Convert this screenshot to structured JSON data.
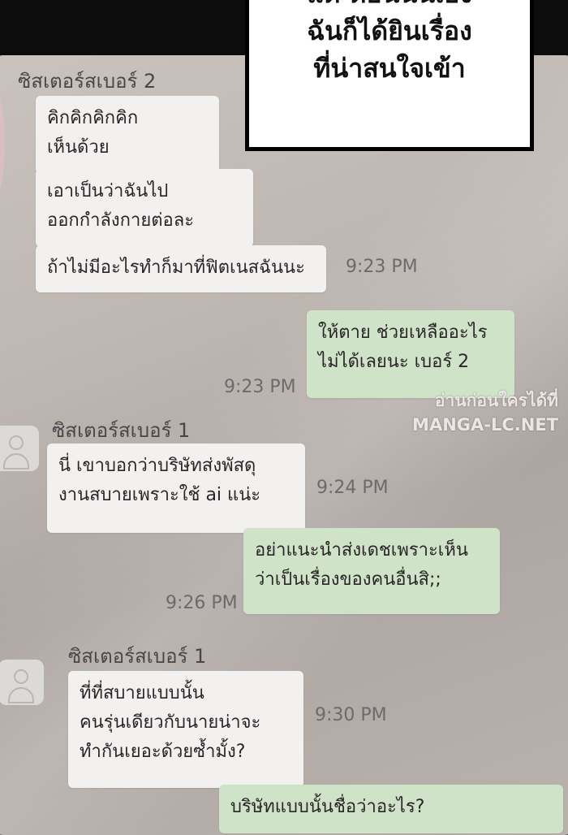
{
  "caption": {
    "partial_line": "แต่ ตอนนั้นเอง",
    "lines": [
      "ฉันก็ได้ยินเรื่อง",
      "ที่น่าสนใจเข้า"
    ]
  },
  "watermark": {
    "line1": "อ่านก่อนใครได้ที่",
    "line2": "MANGA-LC.NET"
  },
  "chat": {
    "sender_2": "ซิสเตอร์สเบอร์ 2",
    "msg1": [
      "คิกคิกคิกคิก",
      "เห็นด้วย"
    ],
    "msg2": [
      "เอาเป็นว่าฉันไป",
      "ออกกำลังกายต่อละ"
    ],
    "msg3": [
      "ถ้าไม่มีอะไรทำก็มาที่ฟิตเนสฉันนะ"
    ],
    "time1": "9:23 PM",
    "reply1": [
      "ให้ตาย ช่วยเหลืออะไร",
      "ไม่ได้เลยนะ เบอร์ 2"
    ],
    "time2": "9:23 PM",
    "sender_1a": "ซิสเตอร์สเบอร์ 1",
    "msg4": [
      "นี่ เขาบอกว่าบริษัทส่งพัสดุ",
      "งานสบายเพราะใช้ ai แน่ะ"
    ],
    "time3": "9:24 PM",
    "reply2": [
      "อย่าแนะนำส่งเดชเพราะเห็น",
      "ว่าเป็นเรื่องของคนอื่นสิ;;"
    ],
    "time4": "9:26 PM",
    "sender_1b": "ซิสเตอร์สเบอร์ 1",
    "msg5": [
      "ที่ที่สบายแบบนั้น",
      "คนรุ่นเดียวกับนายน่าจะ",
      "ทำกันเยอะด้วยซ้ำมั้ง?"
    ],
    "time5": "9:30 PM",
    "reply3": [
      "บริษัทแบบนั้นชื่อว่าอะไร?"
    ]
  }
}
